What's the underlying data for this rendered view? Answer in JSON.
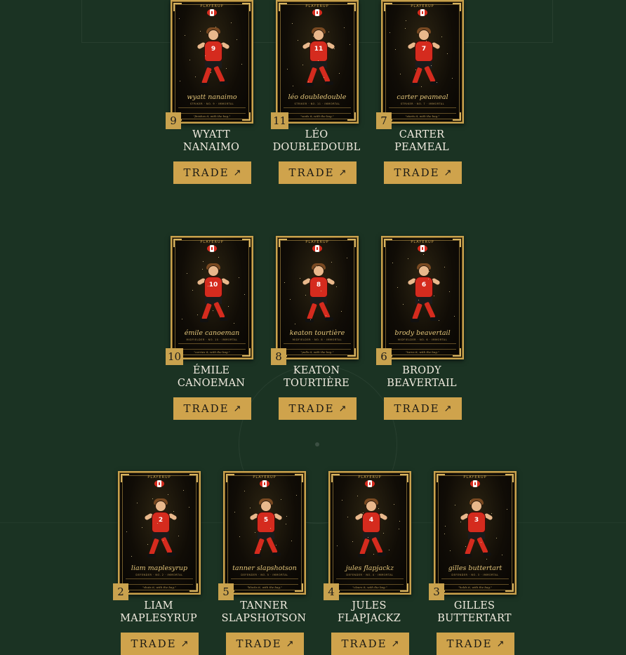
{
  "colors": {
    "background": "#1b3323",
    "gold": "#cfa34c",
    "card_dark": "#100c06",
    "jersey_red": "#d52b1e",
    "text_light": "#f2ece0"
  },
  "card_brand": "PLAYERUP",
  "trade_label": "TRADE",
  "trade_icon": "arrow-up-right-icon",
  "players": [
    {
      "number": "9",
      "name": "WYATT NANAIMO",
      "card_name": "wyatt nanaimo",
      "card_role": "STRIKER · NO. 9 · IMMORTAL",
      "card_quote": "\"finishes it, with the bag.\""
    },
    {
      "number": "11",
      "name": "LÉO DOUBLEDOUBL",
      "card_name": "léo doubledouble",
      "card_role": "STRIKER · NO. 11 · IMMORTAL",
      "card_quote": "\"seals it, with the bag.\""
    },
    {
      "number": "7",
      "name": "CARTER PEAMEAL",
      "card_name": "carter peameal",
      "card_role": "STRIKER · NO. 7 · IMMORTAL",
      "card_quote": "\"starts it, with the bag.\""
    },
    {
      "number": "10",
      "name": "ÉMILE CANOEMAN",
      "card_name": "émile canoeman",
      "card_role": "MIDFIELDER · NO. 10 · IMMORTAL",
      "card_quote": "\"carries it, with the bag.\""
    },
    {
      "number": "8",
      "name": "KEATON TOURTIÈRE",
      "card_name": "keaton tourtière",
      "card_role": "MIDFIELDER · NO. 8 · IMMORTAL",
      "card_quote": "\"pulls it, with the bag.\""
    },
    {
      "number": "6",
      "name": "BRODY BEAVERTAIL",
      "card_name": "brody beavertail",
      "card_role": "MIDFIELDER · NO. 6 · IMMORTAL",
      "card_quote": "\"turns it, with the bag.\""
    },
    {
      "number": "2",
      "name": "LIAM MAPLESYRUP",
      "card_name": "liam maplesyrup",
      "card_role": "DEFENDER · NO. 2 · IMMORTAL",
      "card_quote": "\"shuts it, with the bag.\""
    },
    {
      "number": "5",
      "name": "TANNER SLAPSHOTSON",
      "card_name": "tanner slapshotson",
      "card_role": "DEFENDER · NO. 5 · IMMORTAL",
      "card_quote": "\"blocks it, with the bag.\""
    },
    {
      "number": "4",
      "name": "JULES FLAPJACKZ",
      "card_name": "jules flapjackz",
      "card_role": "DEFENDER · NO. 4 · IMMORTAL",
      "card_quote": "\"clears it, with the bag.\""
    },
    {
      "number": "3",
      "name": "GILLES BUTTERTART",
      "card_name": "gilles buttertart",
      "card_role": "DEFENDER · NO. 3 · IMMORTAL",
      "card_quote": "\"holds it, with the bag.\""
    }
  ]
}
